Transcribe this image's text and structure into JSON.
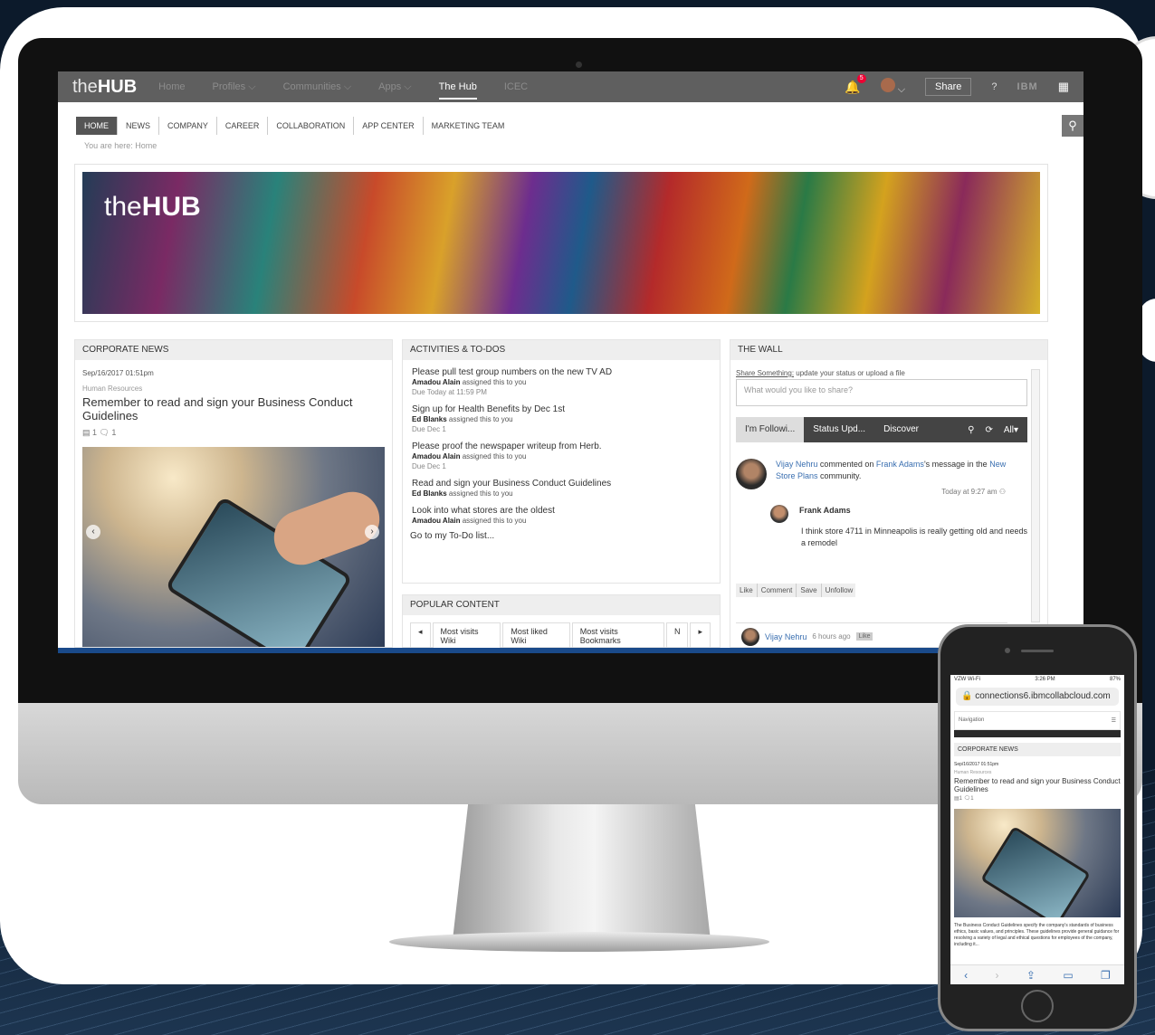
{
  "topbar": {
    "logo_light": "the",
    "logo_bold": "HUB",
    "nav": [
      "Home",
      "Profiles ⌵",
      "Communities ⌵",
      "Apps ⌵",
      "The Hub",
      "ICEC"
    ],
    "notification_count": "5",
    "share_label": "Share",
    "help_glyph": "?",
    "ibm_label": "IBM"
  },
  "subnav": [
    "HOME",
    "NEWS",
    "COMPANY",
    "CAREER",
    "COLLABORATION",
    "APP CENTER",
    "MARKETING TEAM"
  ],
  "breadcrumb": "You are here:  Home",
  "banner": {
    "logo_light": "the",
    "logo_bold": "HUB"
  },
  "corporate_news": {
    "header": "CORPORATE NEWS",
    "date": "Sep/16/2017 01:51pm",
    "category": "Human Resources",
    "title": "Remember to read and sign your Business Conduct Guidelines",
    "meta": "▤ 1  🗨 1"
  },
  "activities": {
    "header": "ACTIVITIES & TO-DOS",
    "items": [
      {
        "title": "Please pull test group numbers on the new TV AD",
        "by": "Amadou Alain",
        "assigned": " assigned this to you",
        "due": "Due Today at 11:59 PM"
      },
      {
        "title": "Sign up for Health Benefits by Dec 1st",
        "by": "Ed Blanks",
        "assigned": " assigned this to you",
        "due": "Due Dec 1"
      },
      {
        "title": "Please proof the newspaper writeup from Herb.",
        "by": "Amadou Alain",
        "assigned": " assigned this to you",
        "due": "Due Dec 1"
      },
      {
        "title": "Read and sign your Business Conduct Guidelines",
        "by": "Ed Blanks",
        "assigned": " assigned this to you",
        "due": ""
      },
      {
        "title": "Look into what stores are the oldest",
        "by": "Amadou Alain",
        "assigned": " assigned this to you",
        "due": ""
      }
    ],
    "link": "Go to my To-Do list..."
  },
  "popular": {
    "header": "POPULAR CONTENT",
    "tabs": [
      "Most visits Wiki",
      "Most liked Wiki",
      "Most visits Bookmarks",
      "N"
    ]
  },
  "wall": {
    "header": "THE WALL",
    "share_label": "Share Something:",
    "share_hint": " update your status or upload a file",
    "placeholder": "What would you like to share?",
    "tabs": [
      "I'm Followi...",
      "Status Upd...",
      "Discover"
    ],
    "filter": "All▾",
    "post": {
      "author": "Vijay Nehru",
      "verb": " commented on ",
      "target": "Frank Adams",
      "mid": "'s message in the ",
      "community": "New Store Plans",
      "end": " community.",
      "time": "Today at 9:27 am",
      "reply_author": "Frank Adams",
      "reply_text": "I think store 4711 in Minneapolis is really getting old and needs a remodel"
    },
    "actions": [
      "Like",
      "Comment",
      "Save",
      "Unfollow"
    ],
    "post2": {
      "author": "Vijay Nehru",
      "time": "6 hours ago",
      "badge": "Like"
    }
  },
  "phone": {
    "carrier": "VZW Wi-Fi",
    "time": "3:26 PM",
    "battery": "87%",
    "url": "connections6.ibmcollabcloud.com",
    "nav_label": "Navigation",
    "header": "CORPORATE NEWS",
    "date": "Sep/16/2017 01:51pm",
    "category": "Human Resources",
    "title": "Remember to read and sign your Business Conduct Guidelines",
    "meta": "▤1 🗨1",
    "body": "The Business Conduct Guidelines specify the company's standards of business ethics, basic values, and principles. These guidelines provide general guidance for resolving a variety of legal and ethical questions for employees of the company, including it..."
  }
}
